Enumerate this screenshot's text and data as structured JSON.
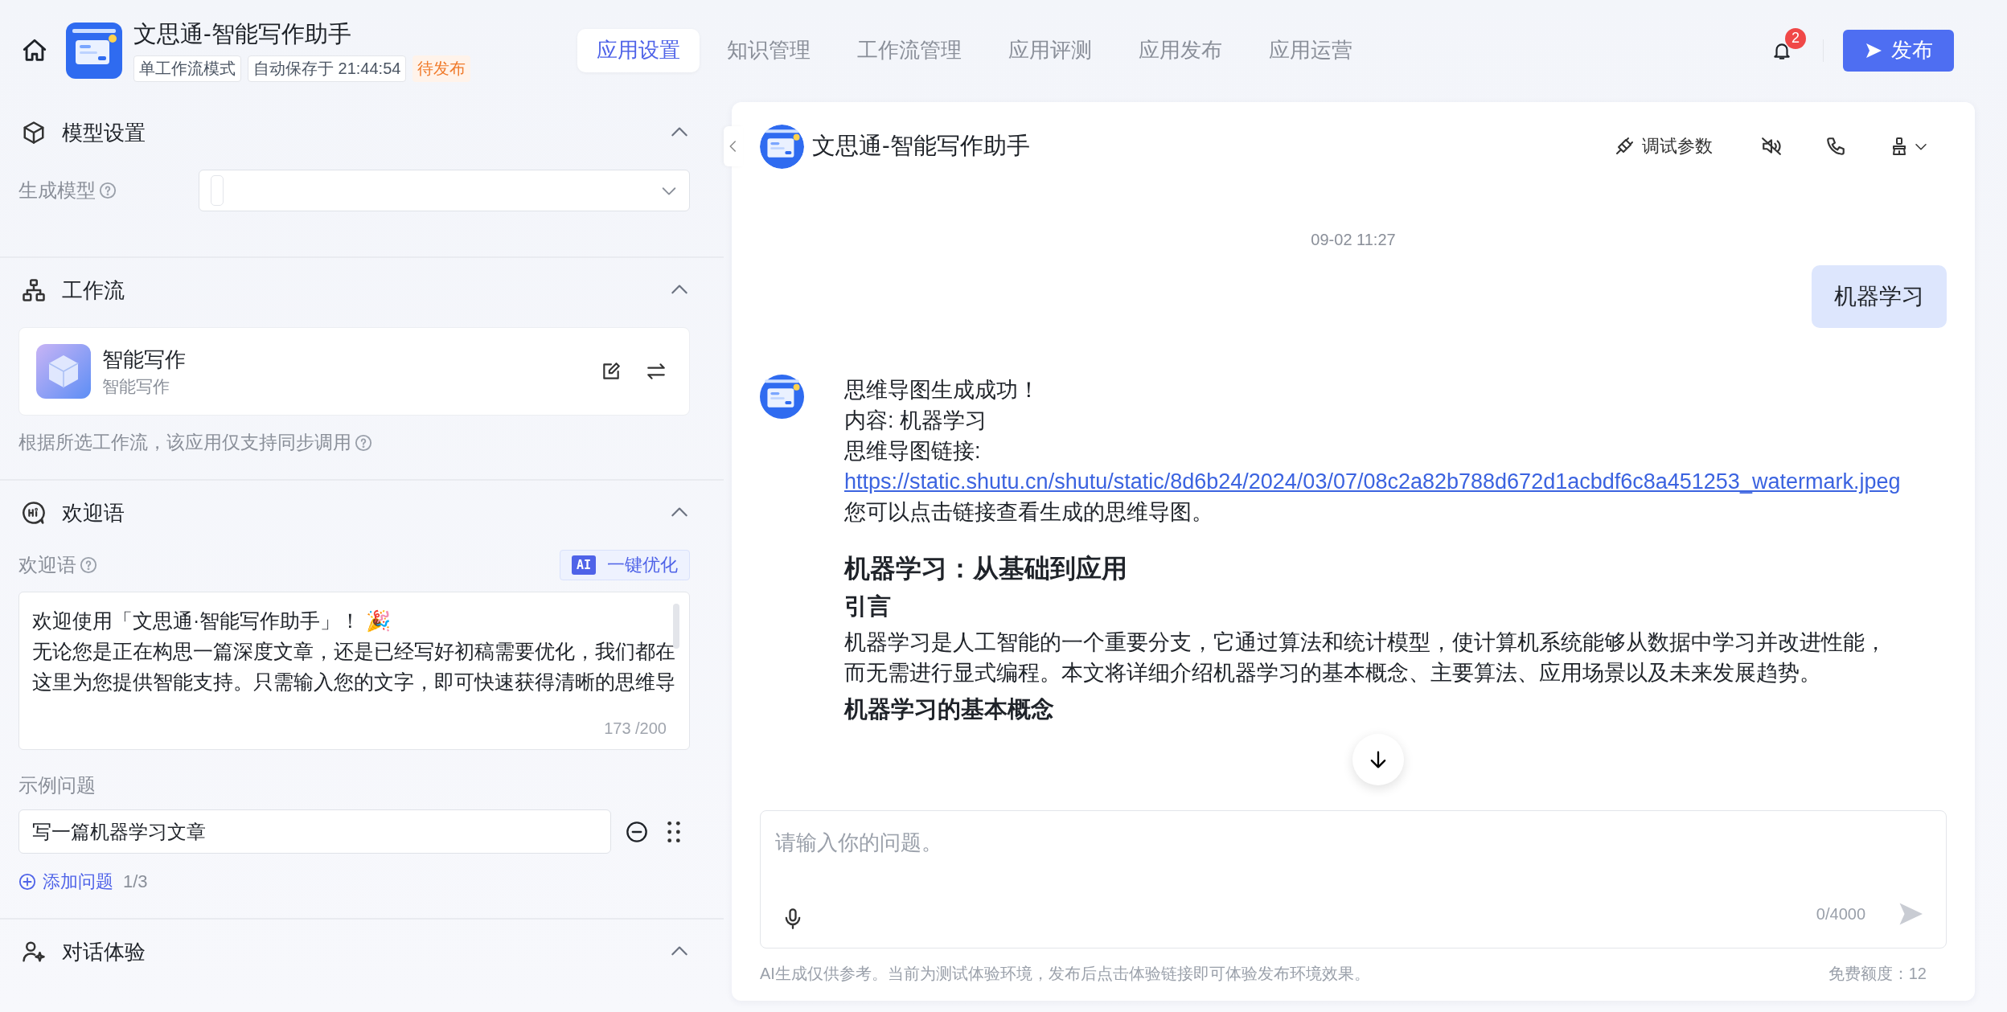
{
  "header": {
    "app_title": "文思通-智能写作助手",
    "tags": [
      {
        "text": "单工作流模式",
        "kind": "tag"
      },
      {
        "text": "自动保存于 21:44:54",
        "kind": "tag"
      },
      {
        "text": "待发布",
        "kind": "status"
      }
    ]
  },
  "tabs": [
    {
      "label": "应用设置",
      "selected": true
    },
    {
      "label": "知识管理",
      "selected": false
    },
    {
      "label": "工作流管理",
      "selected": false
    },
    {
      "label": "应用评测",
      "selected": false
    },
    {
      "label": "应用发布",
      "selected": false
    },
    {
      "label": "应用运营",
      "selected": false
    }
  ],
  "notifications": {
    "count": "2"
  },
  "publish_button": {
    "label": "发布"
  },
  "model_settings": {
    "title": "模型设置",
    "expanded": true,
    "model_label": "生成模型"
  },
  "workflow": {
    "title": "工作流",
    "expanded": true,
    "card": {
      "name": "智能写作",
      "subtitle": "智能写作"
    },
    "note": "根据所选工作流，该应用仅支持同步调用"
  },
  "welcome": {
    "title": "欢迎语",
    "expanded": true,
    "label": "欢迎语",
    "ai_badge": "AI",
    "optimize_button": "一键优化",
    "text_lines": [
      "欢迎使用「文思通·智能写作助手」！ 🎉",
      "无论您是正在构思一篇深度文章，还是已经写好初稿需要优化，我们都在",
      "这里为您提供智能支持。只需输入您的文字，即可快速获得清晰的思维导"
    ],
    "counter": "173 /200",
    "examples_label": "示例问题",
    "examples": [
      "写一篇机器学习文章"
    ],
    "add_button": "添加问题",
    "examples_count": "1/3"
  },
  "chat_experience": {
    "title": "对话体验",
    "expanded": true
  },
  "chat": {
    "title": "文思通-智能写作助手",
    "debug_button": "调试参数",
    "timestamp": "09-02 11:27",
    "messages": [
      {
        "kind": "user",
        "blocks": [
          {
            "kind": "line",
            "text": "机器学习"
          }
        ]
      },
      {
        "kind": "bot",
        "blocks": [
          {
            "kind": "line",
            "text": "思维导图生成成功！"
          },
          {
            "kind": "line",
            "text": "内容: 机器学习"
          },
          {
            "kind": "line",
            "text": "思维导图链接:"
          },
          {
            "kind": "link",
            "text": "https://static.shutu.cn/shutu/static/8d6b24/2024/03/07/08c2a82b788d672d1acbdf6c8a451253_watermark.jpeg"
          },
          {
            "kind": "line",
            "text": "您可以点击链接查看生成的思维导图。"
          },
          {
            "kind": "heading1",
            "text": "机器学习：从基础到应用"
          },
          {
            "kind": "heading2",
            "text": "引言"
          },
          {
            "kind": "paragraph",
            "text": "机器学习是人工智能的一个重要分支，它通过算法和统计模型，使计算机系统能够从数据中学习并改进性能，而无需进行显式编程。本文将详细介绍机器学习的基本概念、主要算法、应用场景以及未来发展趋势。"
          },
          {
            "kind": "heading2",
            "text": "机器学习的基本概念"
          }
        ]
      }
    ],
    "input": {
      "placeholder": "请输入你的问题。",
      "counter": "0/4000"
    },
    "disclaimer": "AI生成仅供参考。当前为测试体验环境，发布后点击体验链接即可体验发布环境效果。",
    "quota": "免费额度：12"
  }
}
